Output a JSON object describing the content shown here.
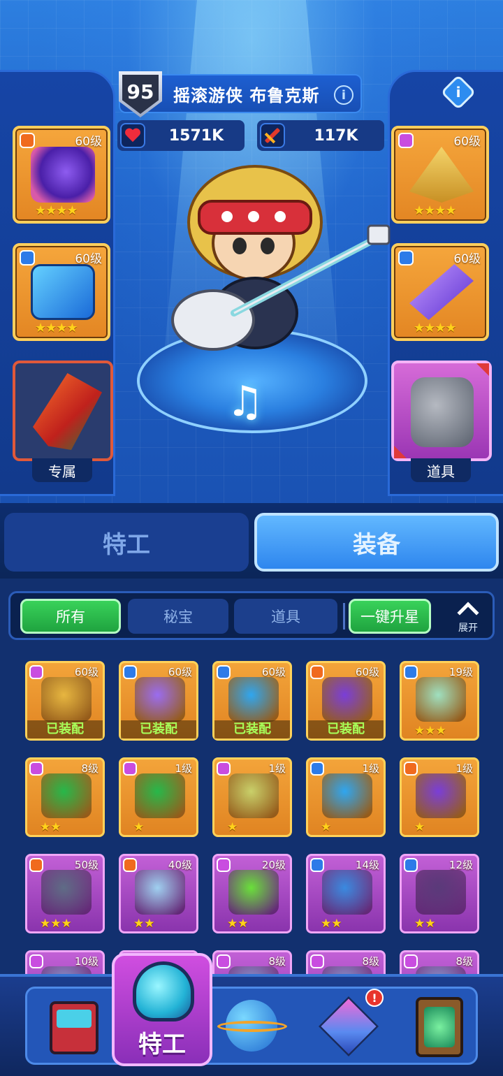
{
  "hero": {
    "level": "95",
    "name": "摇滚游侠 布鲁克斯",
    "hp": "1571K",
    "attack": "117K"
  },
  "equipped_slots": {
    "top_left": {
      "level": "60级",
      "stars": "★★★★",
      "rarity": "orange",
      "item": "purple-gem-ring"
    },
    "mid_left": {
      "level": "60级",
      "stars": "★★★★",
      "rarity": "blue",
      "item": "blue-speaker-cube"
    },
    "top_right": {
      "level": "60级",
      "stars": "★★★★",
      "rarity": "pink",
      "item": "golden-pyramid"
    },
    "mid_right": {
      "level": "60级",
      "stars": "★★★★",
      "rarity": "blue",
      "item": "crystal-shard-ring"
    },
    "exclusive_label": "专属",
    "tool_label": "道具"
  },
  "main_tabs": [
    "特工",
    "装备"
  ],
  "filters": {
    "all": "所有",
    "secret": "秘宝",
    "tools": "道具",
    "star_up": "一键升星",
    "expand": "展开"
  },
  "inventory": [
    {
      "level": "60级",
      "badge": "pink",
      "frame": "orange",
      "status": "已装配",
      "stars": "",
      "art": "golden-pyramid",
      "color": "#e7b640"
    },
    {
      "level": "60级",
      "badge": "blue",
      "frame": "orange",
      "status": "已装配",
      "stars": "",
      "art": "crystal-shard",
      "color": "#9a6cf0"
    },
    {
      "level": "60级",
      "badge": "blue",
      "frame": "orange",
      "status": "已装配",
      "stars": "",
      "art": "speaker-cube",
      "color": "#2fa6f0"
    },
    {
      "level": "60级",
      "badge": "orange",
      "frame": "orange",
      "status": "已装配",
      "stars": "",
      "art": "gem-ring",
      "color": "#7a3ed8"
    },
    {
      "level": "19级",
      "badge": "blue",
      "frame": "orange",
      "status": "",
      "stars": "★★★",
      "art": "green-gem",
      "color": "#9fe0c0"
    },
    {
      "level": "8级",
      "badge": "pink",
      "frame": "orange",
      "status": "",
      "stars": "★★",
      "art": "emerald-box",
      "color": "#27b84a"
    },
    {
      "level": "1级",
      "badge": "pink",
      "frame": "orange",
      "status": "",
      "stars": "★",
      "art": "emerald-box",
      "color": "#27b84a"
    },
    {
      "level": "1级",
      "badge": "pink",
      "frame": "orange",
      "status": "",
      "stars": "★",
      "art": "pocket-watch",
      "color": "#c9d06a"
    },
    {
      "level": "1级",
      "badge": "blue",
      "frame": "orange",
      "status": "",
      "stars": "★",
      "art": "speaker-cube",
      "color": "#2fa6f0"
    },
    {
      "level": "1级",
      "badge": "orange",
      "frame": "orange",
      "status": "",
      "stars": "★",
      "art": "gem-ring",
      "color": "#7a3ed8"
    },
    {
      "level": "50级",
      "badge": "orange",
      "frame": "purple",
      "status": "",
      "stars": "★★★",
      "art": "orb-core",
      "color": "#5f6c86"
    },
    {
      "level": "40级",
      "badge": "orange",
      "frame": "purple",
      "status": "",
      "stars": "★★",
      "art": "capsule",
      "color": "#9fd0f0"
    },
    {
      "level": "20级",
      "badge": "pink",
      "frame": "purple",
      "status": "",
      "stars": "★★",
      "art": "green-flame",
      "color": "#6ae03a"
    },
    {
      "level": "14级",
      "badge": "blue",
      "frame": "purple",
      "status": "",
      "stars": "★★",
      "art": "blue-armor",
      "color": "#3a8ae0"
    },
    {
      "level": "12级",
      "badge": "blue",
      "frame": "purple",
      "status": "",
      "stars": "★★",
      "art": "witch-hat",
      "color": "#5a3a7a"
    },
    {
      "level": "10级",
      "badge": "pink",
      "frame": "purple",
      "status": "",
      "stars": "",
      "art": "partial",
      "color": "#8a9ad0"
    },
    {
      "level": "",
      "badge": "orange",
      "frame": "purple",
      "status": "",
      "stars": "",
      "art": "partial",
      "color": "#8a9ad0"
    },
    {
      "level": "8级",
      "badge": "pink",
      "frame": "purple",
      "status": "",
      "stars": "",
      "art": "partial",
      "color": "#8a9ad0"
    },
    {
      "level": "8级",
      "badge": "pink",
      "frame": "purple",
      "status": "",
      "stars": "",
      "art": "partial",
      "color": "#8a9ad0"
    },
    {
      "level": "8级",
      "badge": "pink",
      "frame": "purple",
      "status": "",
      "stars": "",
      "art": "partial",
      "color": "#8a9ad0"
    }
  ],
  "bottom_nav": {
    "active_label": "特工",
    "items": [
      "shop-machine-icon",
      "agent-helmet-icon",
      "planet-icon",
      "crystal-cube-icon",
      "portal-gate-icon"
    ],
    "alert": "!"
  }
}
